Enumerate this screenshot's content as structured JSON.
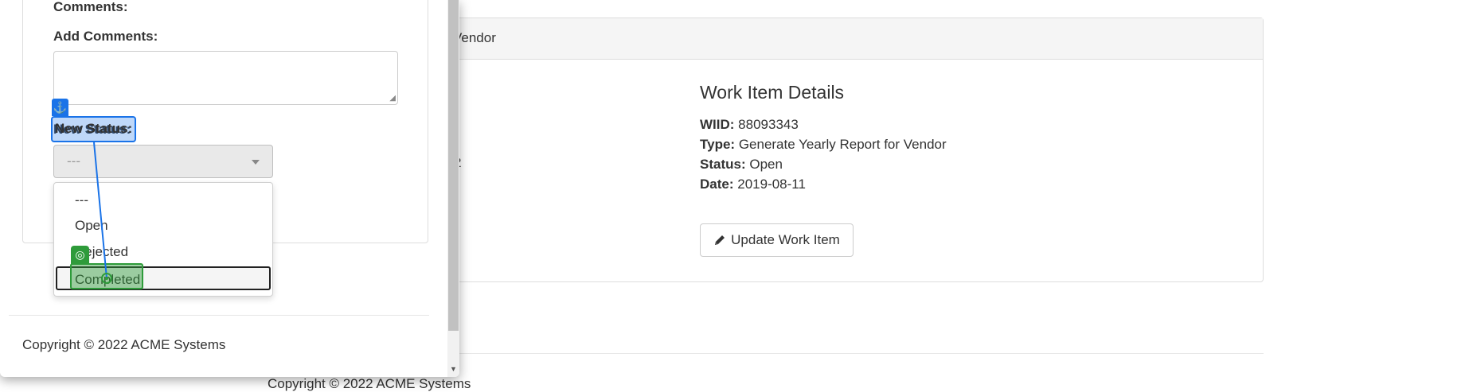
{
  "background": {
    "panel_heading": "Vendor",
    "stray_text": "2",
    "details": {
      "title": "Work Item Details",
      "fields": [
        {
          "label": "WIID:",
          "value": "88093343"
        },
        {
          "label": "Type:",
          "value": "Generate Yearly Report for Vendor"
        },
        {
          "label": "Status:",
          "value": "Open"
        },
        {
          "label": "Date:",
          "value": "2019-08-11"
        }
      ],
      "update_button": "Update Work Item",
      "update_icon": "pencil-icon"
    },
    "copyright": "Copyright © 2022 ACME Systems"
  },
  "modal": {
    "comments_label": "Comments:",
    "add_comments_label": "Add Comments:",
    "add_comments_value": "",
    "new_status_label": "New Status:",
    "status_select_value": "---",
    "status_options": [
      "---",
      "Open",
      "Rejected",
      "Completed"
    ],
    "highlighted_option": "Completed",
    "copyright": "Copyright © 2022 ACME Systems"
  },
  "annotations": {
    "source_icon": "anchor-icon",
    "target_icon": "target-icon",
    "source_color": "#1a73e8",
    "target_color": "#2e9b3a"
  }
}
